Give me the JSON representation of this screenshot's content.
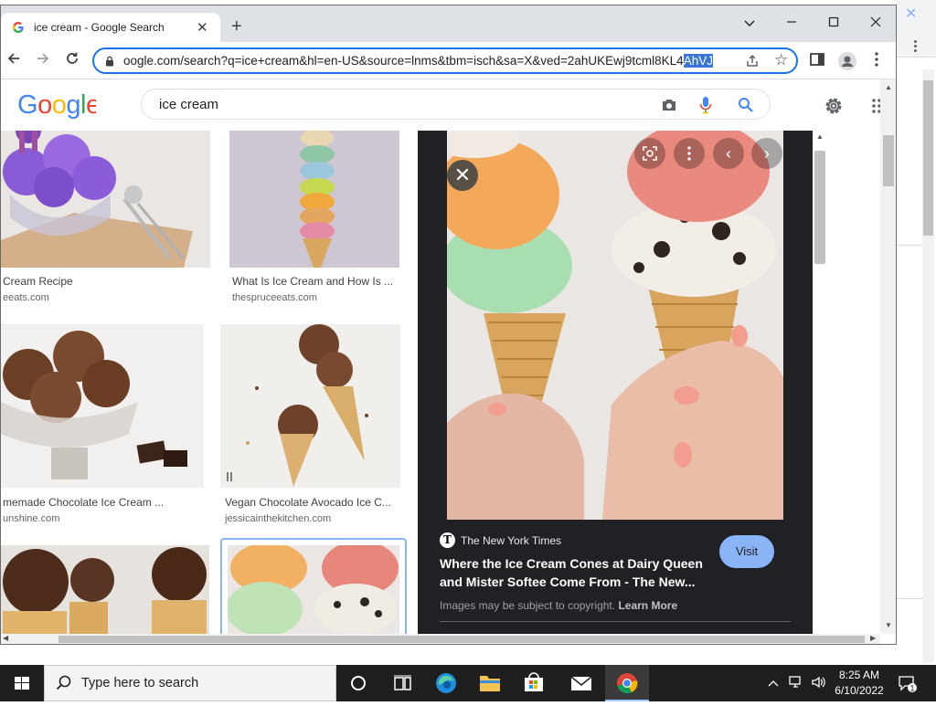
{
  "browser": {
    "tab_title": "ice cream - Google Search",
    "url_text": "oogle.com/search?q=ice+cream&hl=en-US&source=lnms&tbm=isch&sa=X&ved=2ahUKEwj9tcml8KL4",
    "url_selected": "AhVJ"
  },
  "google": {
    "logo": "Google",
    "query": "ice cream"
  },
  "results": [
    {
      "caption": "Cream Recipe",
      "source": "eeats.com"
    },
    {
      "caption": "What Is Ice Cream and How Is ...",
      "source": "thespruceeats.com"
    },
    {
      "caption": "memade Chocolate Ice Cream ...",
      "source": "unshine.com"
    },
    {
      "caption": "Vegan Chocolate Avocado Ice C...",
      "source": "jessicainthekitchen.com"
    }
  ],
  "preview": {
    "publisher": "The New York Times",
    "publisher_logo": "T",
    "title": "Where the Ice Cream Cones at Dairy Queen and Mister Softee Come From - The New...",
    "visit_label": "Visit",
    "copyright_text": "Images may be subject to copyright.",
    "learn_more": "Learn More"
  },
  "taskbar": {
    "search_placeholder": "Type here to search",
    "time": "8:25 AM",
    "date": "6/10/2022",
    "notification_count": "1"
  },
  "colors": {
    "accent": "#1a73e8",
    "preview_bg": "#202124",
    "visit_button": "#8ab4f8",
    "taskbar": "#1f1f1f"
  }
}
